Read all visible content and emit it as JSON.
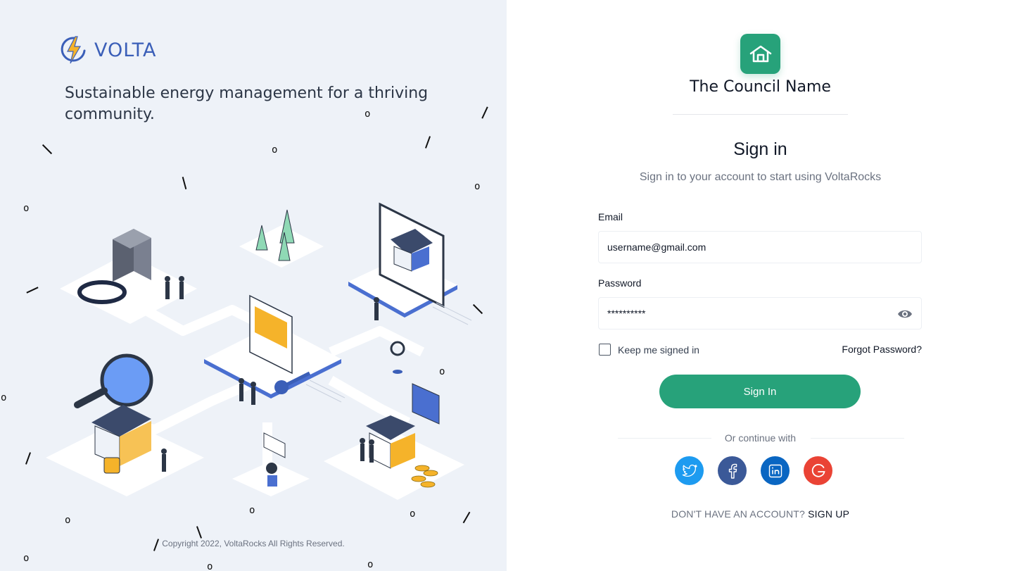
{
  "brand": {
    "name": "VOLTA",
    "tagline": "Sustainable energy management for a thriving community.",
    "copyright": "Copyright 2022, VoltaRocks All Rights Reserved."
  },
  "council": {
    "name": "The Council Name"
  },
  "signin": {
    "title": "Sign in",
    "subtitle": "Sign in to your account to start using VoltaRocks",
    "email_label": "Email",
    "email_value": "username@gmail.com",
    "password_label": "Password",
    "password_value": "**********",
    "remember_label": "Keep me signed in",
    "forgot_label": "Forgot Password?",
    "button_label": "Sign In",
    "or_continue": "Or continue with",
    "no_account": "DON'T HAVE AN ACCOUNT?",
    "signup_label": "SIGN UP"
  },
  "socials": [
    {
      "name": "twitter-icon",
      "color": "#1d9bf0"
    },
    {
      "name": "facebook-icon",
      "color": "#3b5998"
    },
    {
      "name": "linkedin-icon",
      "color": "#0a66c2"
    },
    {
      "name": "google-icon",
      "color": "#ea4335"
    }
  ],
  "colors": {
    "primary": "#27a27a",
    "brand_blue": "#3b5fb8",
    "panel_bg": "#eef2f8"
  }
}
